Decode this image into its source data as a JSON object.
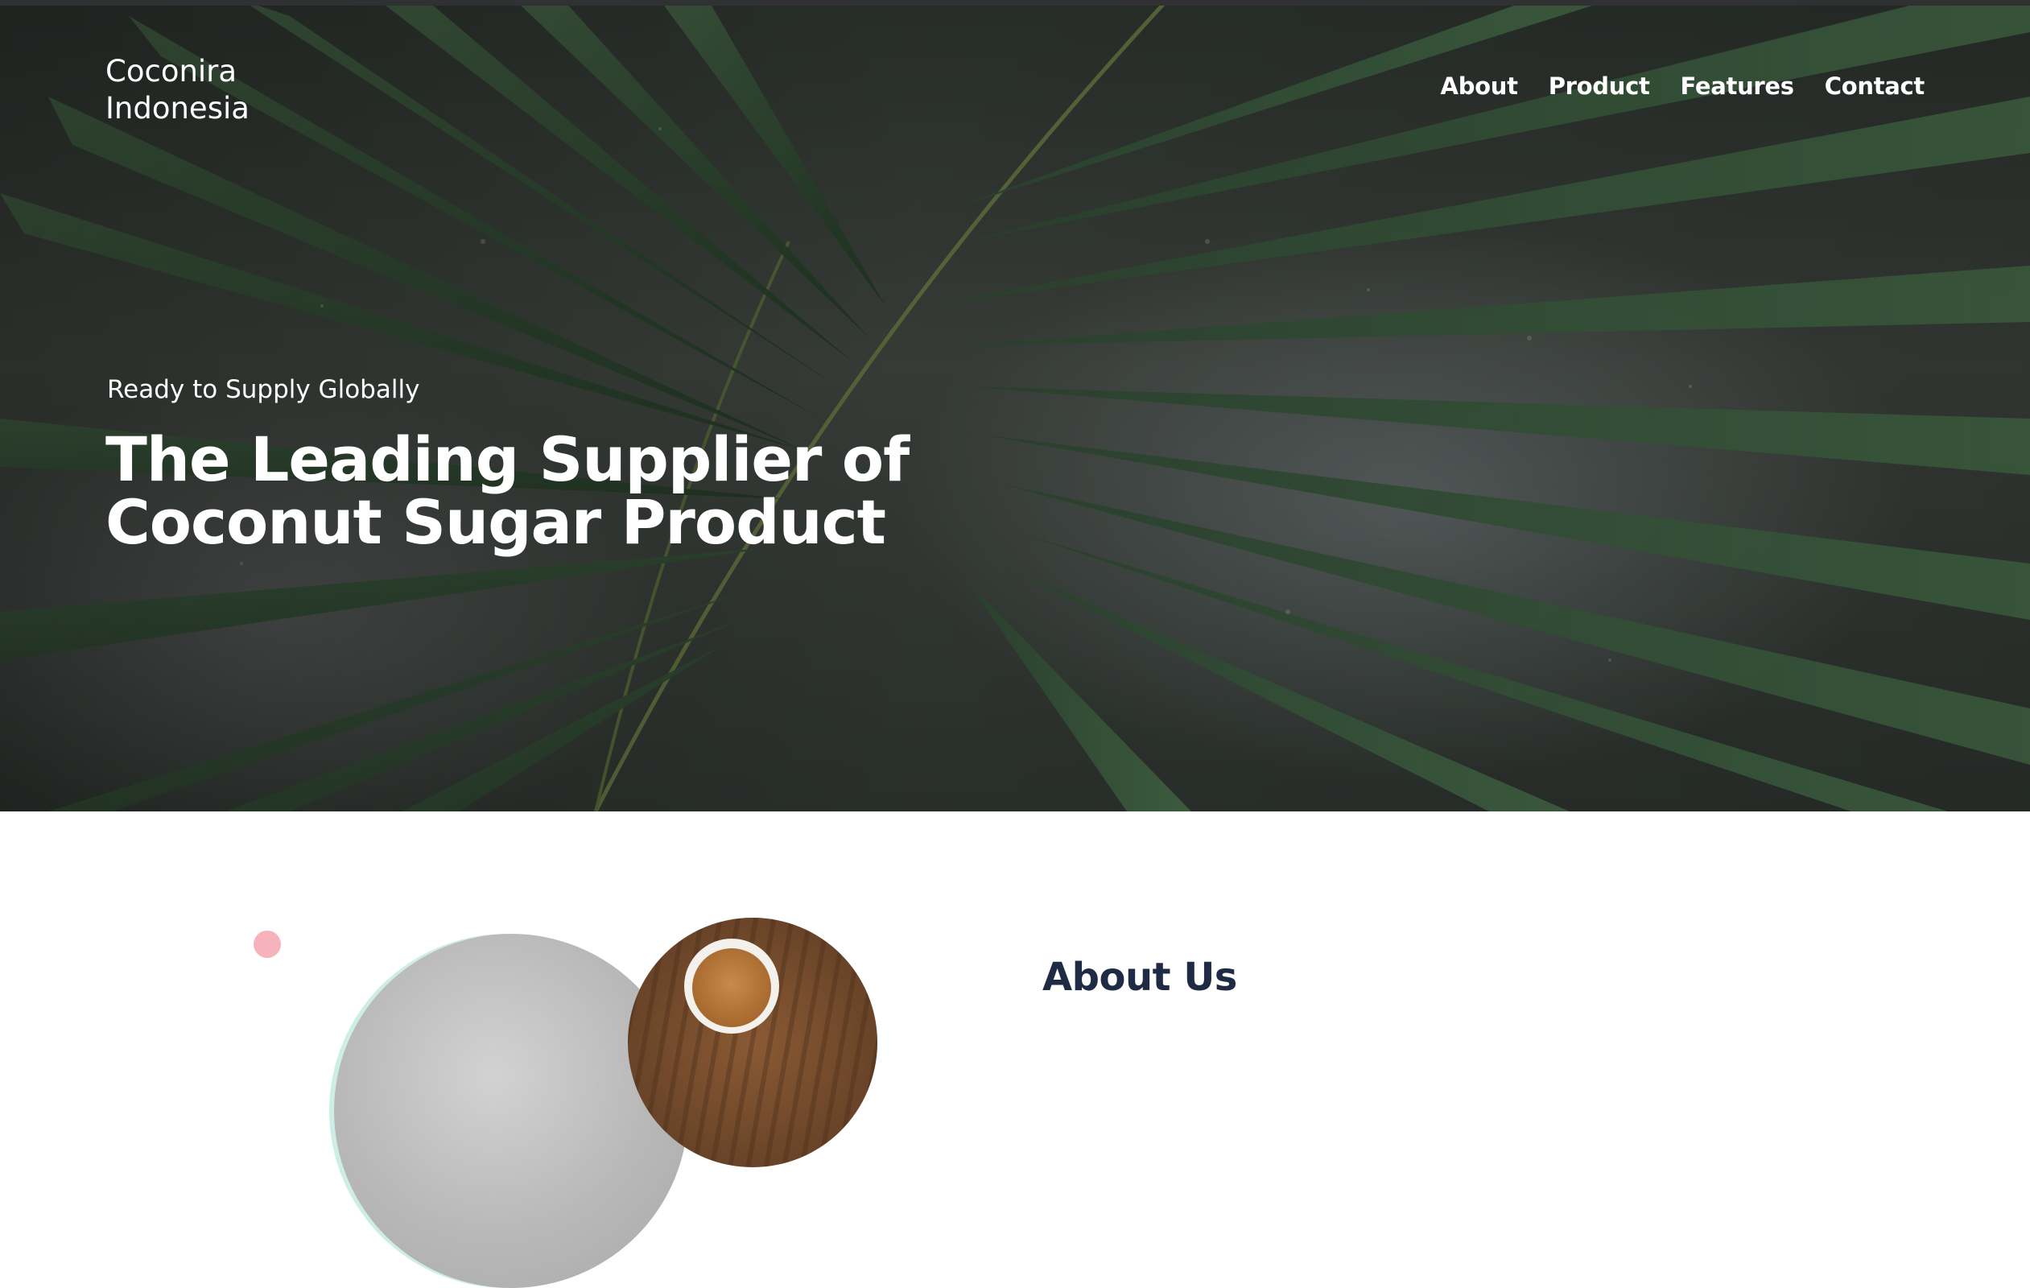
{
  "brand": {
    "line1": "Coconira",
    "line2": "Indonesia"
  },
  "nav": {
    "items": [
      {
        "label": "About"
      },
      {
        "label": "Product"
      },
      {
        "label": "Features"
      },
      {
        "label": "Contact"
      }
    ]
  },
  "hero": {
    "eyebrow": "Ready to Supply Globally",
    "headline_line1": "The Leading Supplier of",
    "headline_line2": "Coconut Sugar Product"
  },
  "about": {
    "title": "About Us"
  },
  "colors": {
    "hero_text": "#ffffff",
    "about_title": "#1f2a44",
    "accent_dot": "#f6b3bc",
    "accent_mint": "#cdeee6"
  }
}
